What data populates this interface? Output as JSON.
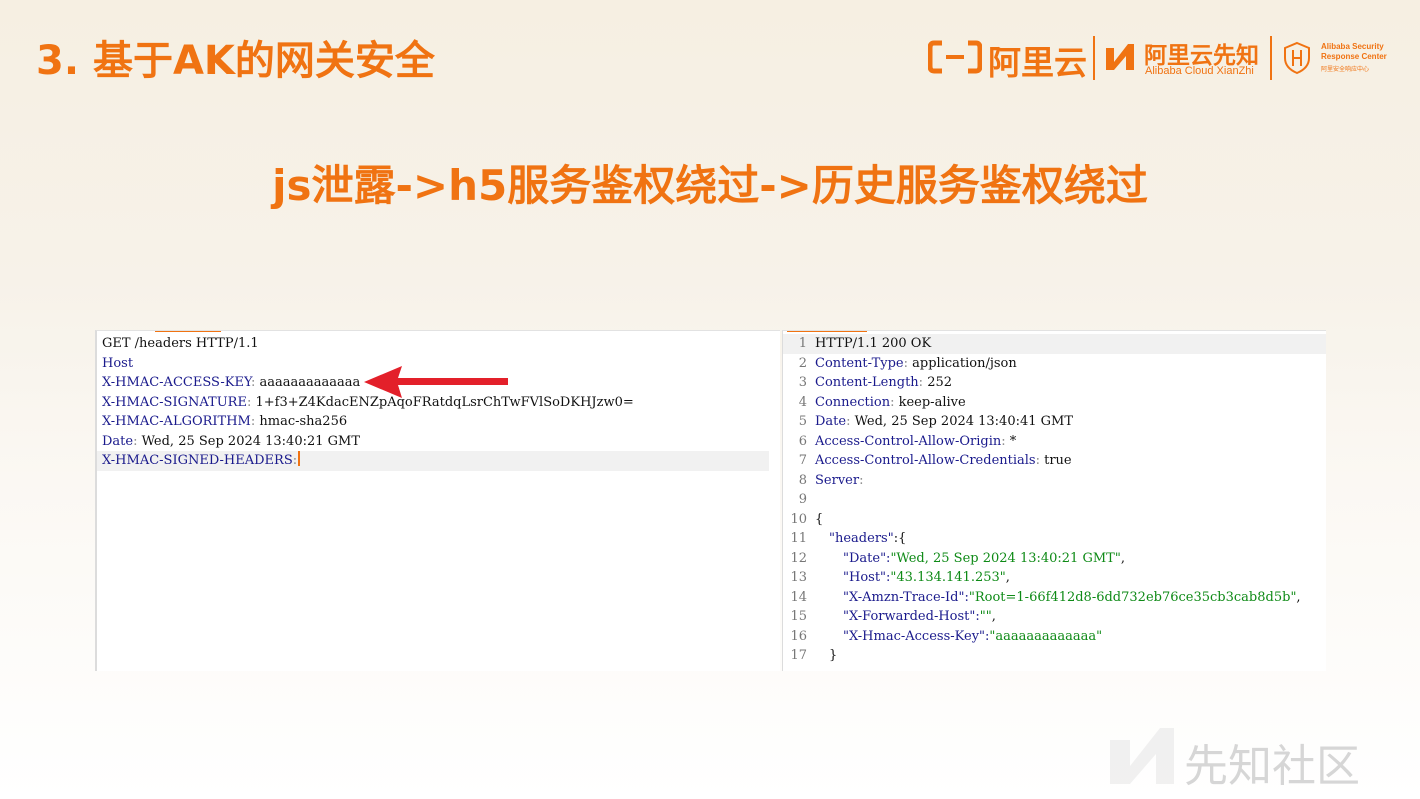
{
  "slide": {
    "title": "3. 基于AK的网关安全",
    "subtitle": "js泄露->h5服务鉴权绕过->历史服务鉴权绕过"
  },
  "branding": {
    "aliyun": "阿里云",
    "xianzhi_cn": "阿里云先知",
    "xianzhi_en": "Alibaba Cloud XianZhi",
    "asrc_line1": "Alibaba Security",
    "asrc_line2": "Response Center",
    "asrc_cn": "阿里安全响应中心",
    "watermark": "先知社区",
    "accent_color": "#f07312"
  },
  "request": {
    "request_line": "GET /headers HTTP/1.1",
    "headers": [
      {
        "name": "Host",
        "value": ""
      },
      {
        "name": "X-HMAC-ACCESS-KEY",
        "value": "aaaaaaaaaaaaa"
      },
      {
        "name": "X-HMAC-SIGNATURE",
        "value": "1+f3+Z4KdacENZpAqoFRatdqLsrChTwFVlSoDKHJzw0="
      },
      {
        "name": "X-HMAC-ALGORITHM",
        "value": "hmac-sha256"
      },
      {
        "name": "Date",
        "value": "Wed, 25 Sep 2024 13:40:21 GMT"
      },
      {
        "name": "X-HMAC-SIGNED-HEADERS",
        "value": ""
      }
    ]
  },
  "response": {
    "lines": [
      {
        "n": "1",
        "text": "HTTP/1.1 200 OK"
      },
      {
        "n": "2",
        "name": "Content-Type",
        "value": "application/json"
      },
      {
        "n": "3",
        "name": "Content-Length",
        "value": "252"
      },
      {
        "n": "4",
        "name": "Connection",
        "value": "keep-alive"
      },
      {
        "n": "5",
        "name": "Date",
        "value": "Wed, 25 Sep 2024 13:40:41 GMT"
      },
      {
        "n": "6",
        "name": "Access-Control-Allow-Origin",
        "value": "*"
      },
      {
        "n": "7",
        "name": "Access-Control-Allow-Credentials",
        "value": "true"
      },
      {
        "n": "8",
        "name": "Server",
        "value": ""
      },
      {
        "n": "9"
      },
      {
        "n": "10",
        "text": "{"
      },
      {
        "n": "11",
        "json_key": "headers",
        "tail": ":{"
      },
      {
        "n": "12",
        "json_key": "Date",
        "json_val": "Wed, 25 Sep 2024 13:40:21 GMT",
        "tail": ","
      },
      {
        "n": "13",
        "json_key": "Host",
        "json_val": "43.134.141.253",
        "tail": ","
      },
      {
        "n": "14",
        "json_key": "X-Amzn-Trace-Id",
        "json_val": "Root=1-66f412d8-6dd732eb76ce35cb3cab8d5b",
        "tail": ","
      },
      {
        "n": "15",
        "json_key": "X-Forwarded-Host",
        "json_val": "",
        "tail": ","
      },
      {
        "n": "16",
        "json_key": "X-Hmac-Access-Key",
        "json_val": "aaaaaaaaaaaaa",
        "tail": ""
      },
      {
        "n": "17",
        "text": "}"
      }
    ]
  }
}
